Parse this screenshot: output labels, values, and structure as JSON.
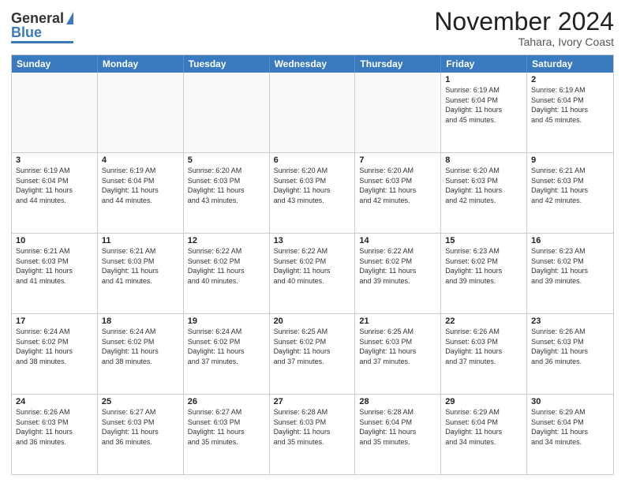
{
  "header": {
    "logo_top": "General",
    "logo_bottom": "Blue",
    "month": "November 2024",
    "location": "Tahara, Ivory Coast"
  },
  "weekdays": [
    "Sunday",
    "Monday",
    "Tuesday",
    "Wednesday",
    "Thursday",
    "Friday",
    "Saturday"
  ],
  "rows": [
    [
      {
        "day": "",
        "empty": true
      },
      {
        "day": "",
        "empty": true
      },
      {
        "day": "",
        "empty": true
      },
      {
        "day": "",
        "empty": true
      },
      {
        "day": "",
        "empty": true
      },
      {
        "day": "1",
        "rise": "6:19 AM",
        "set": "6:04 PM",
        "daylight": "11 hours and 45 minutes."
      },
      {
        "day": "2",
        "rise": "6:19 AM",
        "set": "6:04 PM",
        "daylight": "11 hours and 45 minutes."
      }
    ],
    [
      {
        "day": "3",
        "rise": "6:19 AM",
        "set": "6:04 PM",
        "daylight": "11 hours and 44 minutes."
      },
      {
        "day": "4",
        "rise": "6:19 AM",
        "set": "6:04 PM",
        "daylight": "11 hours and 44 minutes."
      },
      {
        "day": "5",
        "rise": "6:20 AM",
        "set": "6:03 PM",
        "daylight": "11 hours and 43 minutes."
      },
      {
        "day": "6",
        "rise": "6:20 AM",
        "set": "6:03 PM",
        "daylight": "11 hours and 43 minutes."
      },
      {
        "day": "7",
        "rise": "6:20 AM",
        "set": "6:03 PM",
        "daylight": "11 hours and 42 minutes."
      },
      {
        "day": "8",
        "rise": "6:20 AM",
        "set": "6:03 PM",
        "daylight": "11 hours and 42 minutes."
      },
      {
        "day": "9",
        "rise": "6:21 AM",
        "set": "6:03 PM",
        "daylight": "11 hours and 42 minutes."
      }
    ],
    [
      {
        "day": "10",
        "rise": "6:21 AM",
        "set": "6:03 PM",
        "daylight": "11 hours and 41 minutes."
      },
      {
        "day": "11",
        "rise": "6:21 AM",
        "set": "6:03 PM",
        "daylight": "11 hours and 41 minutes."
      },
      {
        "day": "12",
        "rise": "6:22 AM",
        "set": "6:02 PM",
        "daylight": "11 hours and 40 minutes."
      },
      {
        "day": "13",
        "rise": "6:22 AM",
        "set": "6:02 PM",
        "daylight": "11 hours and 40 minutes."
      },
      {
        "day": "14",
        "rise": "6:22 AM",
        "set": "6:02 PM",
        "daylight": "11 hours and 39 minutes."
      },
      {
        "day": "15",
        "rise": "6:23 AM",
        "set": "6:02 PM",
        "daylight": "11 hours and 39 minutes."
      },
      {
        "day": "16",
        "rise": "6:23 AM",
        "set": "6:02 PM",
        "daylight": "11 hours and 39 minutes."
      }
    ],
    [
      {
        "day": "17",
        "rise": "6:24 AM",
        "set": "6:02 PM",
        "daylight": "11 hours and 38 minutes."
      },
      {
        "day": "18",
        "rise": "6:24 AM",
        "set": "6:02 PM",
        "daylight": "11 hours and 38 minutes."
      },
      {
        "day": "19",
        "rise": "6:24 AM",
        "set": "6:02 PM",
        "daylight": "11 hours and 37 minutes."
      },
      {
        "day": "20",
        "rise": "6:25 AM",
        "set": "6:02 PM",
        "daylight": "11 hours and 37 minutes."
      },
      {
        "day": "21",
        "rise": "6:25 AM",
        "set": "6:03 PM",
        "daylight": "11 hours and 37 minutes."
      },
      {
        "day": "22",
        "rise": "6:26 AM",
        "set": "6:03 PM",
        "daylight": "11 hours and 37 minutes."
      },
      {
        "day": "23",
        "rise": "6:26 AM",
        "set": "6:03 PM",
        "daylight": "11 hours and 36 minutes."
      }
    ],
    [
      {
        "day": "24",
        "rise": "6:26 AM",
        "set": "6:03 PM",
        "daylight": "11 hours and 36 minutes."
      },
      {
        "day": "25",
        "rise": "6:27 AM",
        "set": "6:03 PM",
        "daylight": "11 hours and 36 minutes."
      },
      {
        "day": "26",
        "rise": "6:27 AM",
        "set": "6:03 PM",
        "daylight": "11 hours and 35 minutes."
      },
      {
        "day": "27",
        "rise": "6:28 AM",
        "set": "6:03 PM",
        "daylight": "11 hours and 35 minutes."
      },
      {
        "day": "28",
        "rise": "6:28 AM",
        "set": "6:04 PM",
        "daylight": "11 hours and 35 minutes."
      },
      {
        "day": "29",
        "rise": "6:29 AM",
        "set": "6:04 PM",
        "daylight": "11 hours and 34 minutes."
      },
      {
        "day": "30",
        "rise": "6:29 AM",
        "set": "6:04 PM",
        "daylight": "11 hours and 34 minutes."
      }
    ]
  ],
  "labels": {
    "sunrise": "Sunrise:",
    "sunset": "Sunset:",
    "daylight": "Daylight:"
  }
}
